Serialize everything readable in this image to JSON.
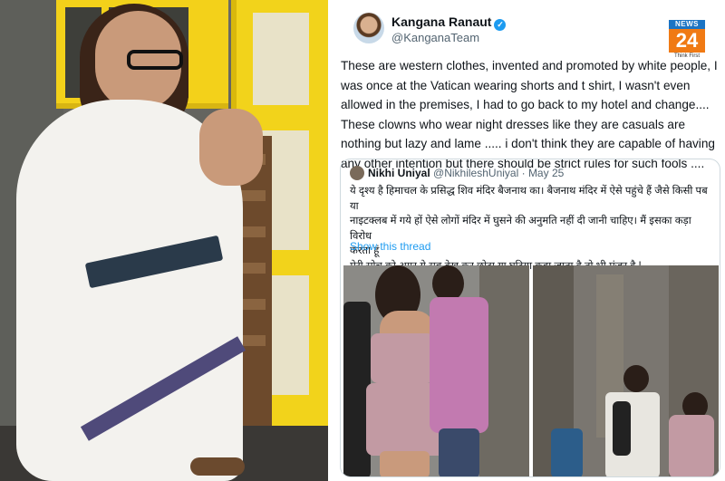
{
  "tweet": {
    "author_name": "Kangana Ranaut",
    "author_handle": "@KanganaTeam",
    "verified_glyph": "✓",
    "body": "These are western clothes, invented and promoted by white people, I was once at the Vatican wearing shorts and t shirt, I wasn't even allowed in the premises, I had to go back to my hotel and change.... These clowns who wear night dresses like they are casuals are nothing but lazy and lame ..... i don't think they are capable of having any other intention but there should be strict rules for such fools ...."
  },
  "logo": {
    "top": "NEWS",
    "number": "24",
    "tagline": "Think First"
  },
  "quoted_tweet": {
    "author_name": "Nikhi Uniyal",
    "author_handle": "@NikhileshUniyal",
    "separator": "·",
    "date": "May 25",
    "lines": [
      "ये दृश्य है हिमाचल के प्रसिद्ध शिव मंदिर बैजनाथ का। बैजनाथ मंदिर में ऐसे पहुंचे हैं जैसे किसी पब या",
      "नाइटक्लब में गये हों ऐसे लोगों मंदिर में घुसने की अनुमति नहीं दी जानी चाहिए। मैं इसका कड़ा विरोध",
      "करता हूं",
      " मेरी सोच को अगर ये सब देख कर छोटा या घटिया कहा जाता है तो भी मंजूर है !"
    ],
    "show_thread": "Show this thread"
  },
  "icons": {
    "verified": "verified-badge-icon",
    "logo": "news24-logo"
  },
  "colors": {
    "link": "#1d9bf0",
    "text": "#0f1419",
    "muted": "#536471",
    "logo_orange": "#f07a14",
    "logo_blue": "#1b74c4"
  }
}
